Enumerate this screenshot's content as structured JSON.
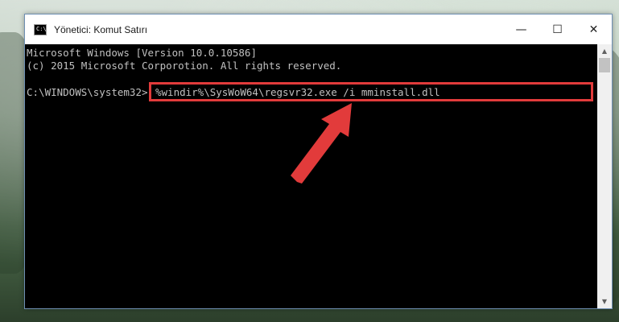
{
  "window": {
    "title": "Yönetici: Komut Satırı",
    "icon_text": "C:\\_",
    "controls": {
      "minimize": "—",
      "maximize": "☐",
      "close": "✕"
    }
  },
  "console": {
    "lines": [
      "Microsoft Windows [Version 10.0.10586]",
      "(c) 2015 Microsoft Corporotion. All rights reserved."
    ],
    "prompt": "C:\\WINDOWS\\system32>",
    "command": "%windir%\\SysWoW64\\regsvr32.exe /i mminstall.dll"
  },
  "scrollbar": {
    "up": "▲",
    "down": "▼"
  },
  "colors": {
    "console_bg": "#000000",
    "console_text": "#c0c0c0",
    "highlight": "#e23b3b"
  },
  "annotation": {
    "icon": "arrow-icon"
  }
}
